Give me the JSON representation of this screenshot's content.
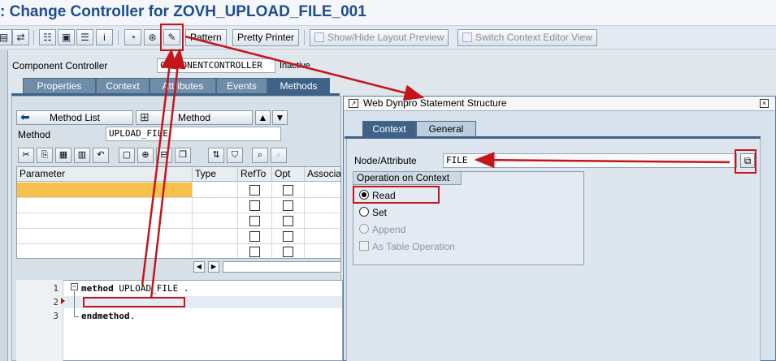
{
  "title": ": Change Controller for ZOVH_UPLOAD_FILE_001",
  "toolbar": {
    "pattern": "Pattern",
    "pretty_printer": "Pretty Printer",
    "show_hide_layout": "Show/Hide Layout Preview",
    "switch_context": "Switch Context Editor View"
  },
  "controller": {
    "label": "Component Controller",
    "value": "COMPONENTCONTROLLER",
    "status": "Inactive"
  },
  "tabs": [
    "Properties",
    "Context",
    "Attributes",
    "Events",
    "Methods"
  ],
  "method_nav": {
    "method_list": "Method List",
    "method": "Method"
  },
  "method": {
    "label": "Method",
    "value": "UPLOAD_FILE"
  },
  "param_table": {
    "headers": [
      "Parameter",
      "Type",
      "RefTo",
      "Opt",
      "Associa"
    ]
  },
  "code": {
    "lines": [
      "1",
      "2",
      "3"
    ],
    "line1_kw": "method",
    "line1_rest": " UPLOAD_FILE .",
    "line3_kw": "endmethod",
    "line3_rest": "."
  },
  "dialog": {
    "title": "Web Dynpro Statement Structure",
    "tabs": [
      "Context",
      "General"
    ],
    "node_attribute_label": "Node/Attribute",
    "node_attribute_value": "FILE",
    "operation_title": "Operation on Context",
    "options": [
      "Read",
      "Set",
      "Append"
    ],
    "table_op": "As Table Operation",
    "selected": "Read"
  },
  "colors": {
    "annotation": "#c3161c",
    "title": "#1e4e8c",
    "tab_active": "#3f6288"
  }
}
